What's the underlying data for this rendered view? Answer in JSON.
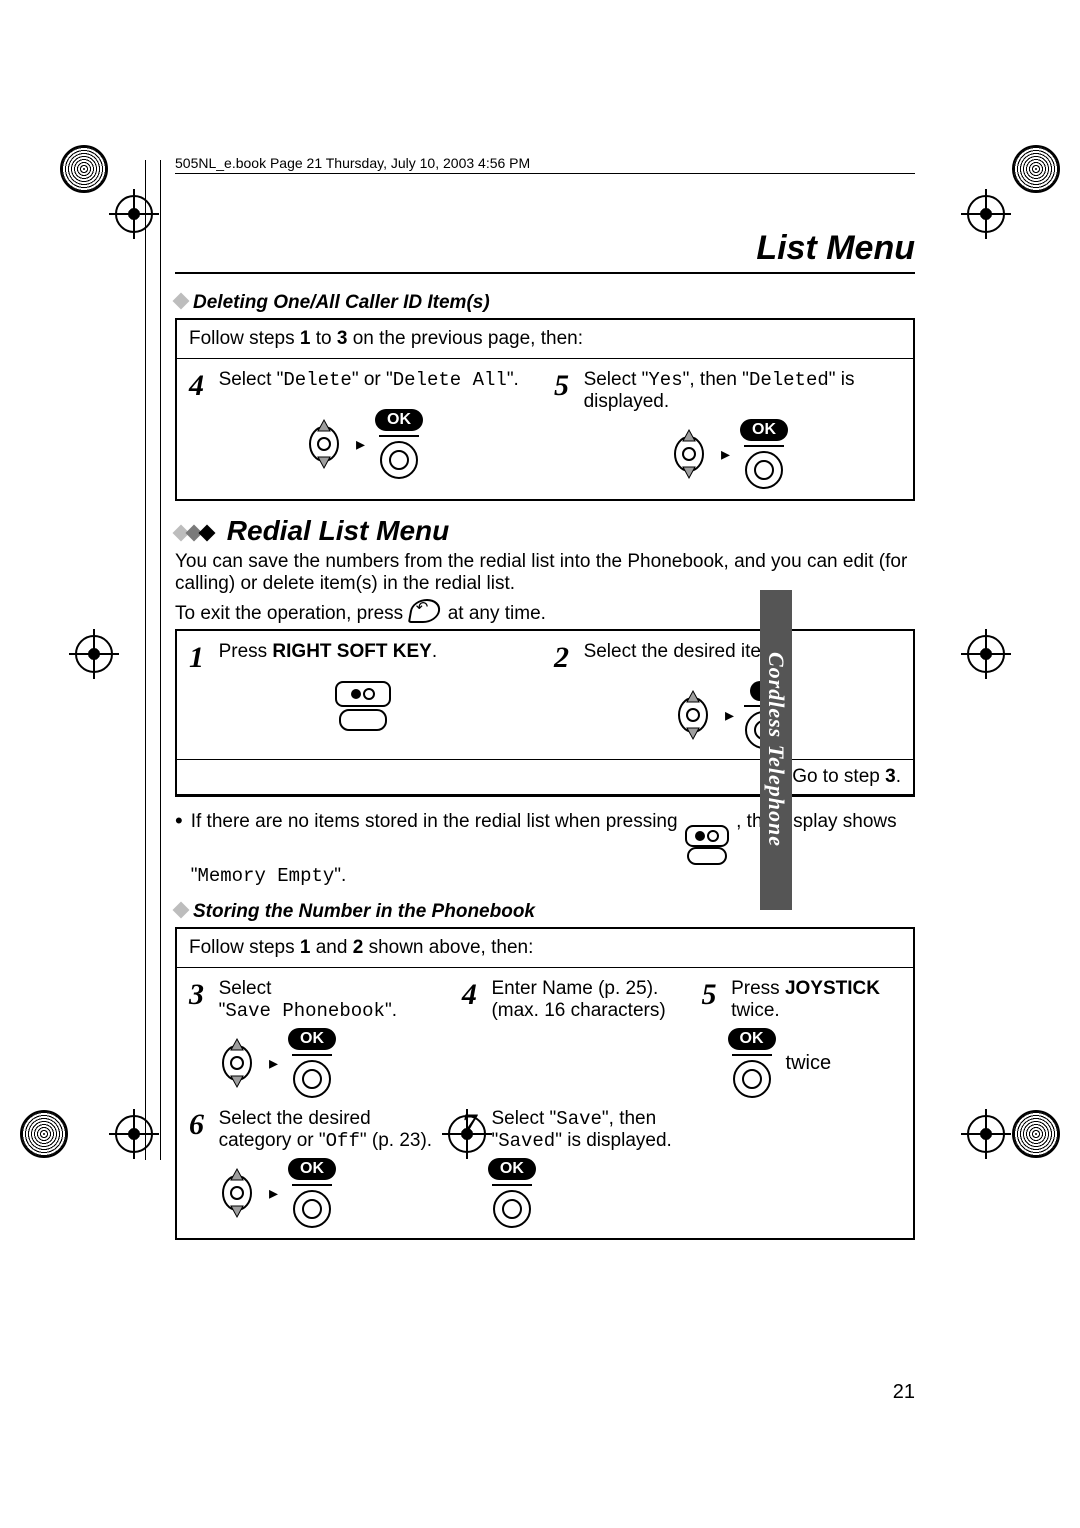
{
  "runhead": "505NL_e.book  Page 21  Thursday, July 10, 2003  4:56 PM",
  "page_title": "List Menu",
  "side_tab": "Cordless Telephone",
  "page_number": "21",
  "labels": {
    "ok": "OK",
    "twice": "twice"
  },
  "del": {
    "heading": "Deleting One/All Caller ID Item(s)",
    "intro_a": "Follow steps ",
    "intro_b": "1",
    "intro_c": " to ",
    "intro_d": "3",
    "intro_e": " on the previous page, then:",
    "s4_num": "4",
    "s4_a": "Select \"",
    "s4_b": "Delete",
    "s4_c": "\" or \"",
    "s4_d": "Delete All",
    "s4_e": "\".",
    "s5_num": "5",
    "s5_a": "Select \"",
    "s5_b": "Yes",
    "s5_c": "\", then \"",
    "s5_d": "Deleted",
    "s5_e": "\" is displayed."
  },
  "redial": {
    "heading": "Redial List Menu",
    "p1": "You can save the numbers from the redial list into the Phonebook, and you can edit (for calling) or delete item(s) in the redial list.",
    "p2_a": "To exit the operation, press ",
    "p2_b": " at any time.",
    "s1_num": "1",
    "s1_a": "Press ",
    "s1_b": "RIGHT SOFT KEY",
    "s1_c": ".",
    "s2_num": "2",
    "s2_a": "Select the desired item.",
    "goto_a": "Go to step ",
    "goto_b": "3",
    "goto_c": ".",
    "note_a": "If there are no items stored in the redial list when pressing ",
    "note_b": ", the display shows \"",
    "note_c": "Memory Empty",
    "note_d": "\"."
  },
  "store": {
    "heading": "Storing the Number in the Phonebook",
    "intro_a": "Follow steps ",
    "intro_b": "1",
    "intro_c": " and ",
    "intro_d": "2",
    "intro_e": " shown above, then:",
    "s3_num": "3",
    "s3_a": "Select",
    "s3_b": "\"",
    "s3_c": "Save Phonebook",
    "s3_d": "\".",
    "s4_num": "4",
    "s4_a": "Enter Name (p. 25).",
    "s4_b": "(max. 16 characters)",
    "s5_num": "5",
    "s5_a": "Press ",
    "s5_b": "JOYSTICK",
    "s5_c": " twice.",
    "s6_num": "6",
    "s6_a": "Select the desired category or \"",
    "s6_b": "Off",
    "s6_c": "\" (p. 23).",
    "s7_num": "7",
    "s7_a": "Select \"",
    "s7_b": "Save",
    "s7_c": "\", then \"",
    "s7_d": "Saved",
    "s7_e": "\" is displayed."
  }
}
